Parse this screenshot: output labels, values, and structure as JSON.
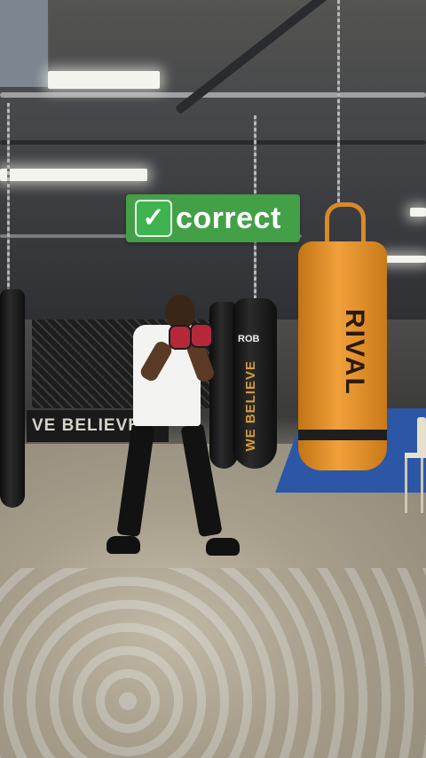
{
  "caption": {
    "icon": "check-mark-icon",
    "glyph": "✓",
    "text": "correct",
    "background": "#43a047"
  },
  "scene": {
    "banner_text": "VE BELIEVE",
    "bag_black_text": "WE BELIEVE",
    "bag_black_logo": "ROB",
    "bag_orange_text": "RIVAL"
  }
}
